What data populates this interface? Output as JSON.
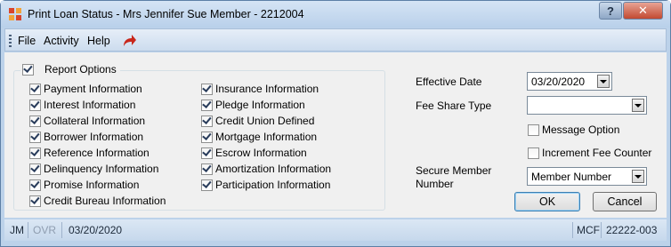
{
  "window": {
    "title": "Print Loan Status - Mrs Jennifer Sue Member - 2212004",
    "help_label": "?",
    "close_label": "✕"
  },
  "menu": {
    "items": [
      "File",
      "Activity",
      "Help"
    ],
    "icon": "redo-arrow-icon"
  },
  "report_options": {
    "label": "Report Options",
    "checked": true,
    "left_column": [
      {
        "label": "Payment Information",
        "checked": true
      },
      {
        "label": "Interest Information",
        "checked": true
      },
      {
        "label": "Collateral Information",
        "checked": true
      },
      {
        "label": "Borrower Information",
        "checked": true
      },
      {
        "label": "Reference Information",
        "checked": true
      },
      {
        "label": "Delinquency Information",
        "checked": true
      },
      {
        "label": "Promise Information",
        "checked": true
      },
      {
        "label": "Credit Bureau Information",
        "checked": true
      }
    ],
    "right_column": [
      {
        "label": "Insurance Information",
        "checked": true
      },
      {
        "label": "Pledge Information",
        "checked": true
      },
      {
        "label": "Credit Union Defined",
        "checked": true
      },
      {
        "label": "Mortgage Information",
        "checked": true
      },
      {
        "label": "Escrow Information",
        "checked": true
      },
      {
        "label": "Amortization Information",
        "checked": true
      },
      {
        "label": "Participation Information",
        "checked": true
      }
    ]
  },
  "form": {
    "effective_date_label": "Effective Date",
    "effective_date_value": "03/20/2020",
    "fee_share_type_label": "Fee Share Type",
    "fee_share_type_value": "",
    "message_option_label": "Message Option",
    "message_option_checked": false,
    "increment_fee_counter_label": "Increment Fee Counter",
    "increment_fee_counter_checked": false,
    "secure_member_number_label_line1": "Secure Member",
    "secure_member_number_label_line2": "Number",
    "secure_member_number_value": "Member Number",
    "ok_label": "OK",
    "cancel_label": "Cancel"
  },
  "status": {
    "user": "JM",
    "mode": "OVR",
    "date": "03/20/2020",
    "system": "MCF",
    "code": "22222-003"
  },
  "colors": {
    "accent": "#bcd2ea",
    "redo_icon": "#c8271c"
  }
}
